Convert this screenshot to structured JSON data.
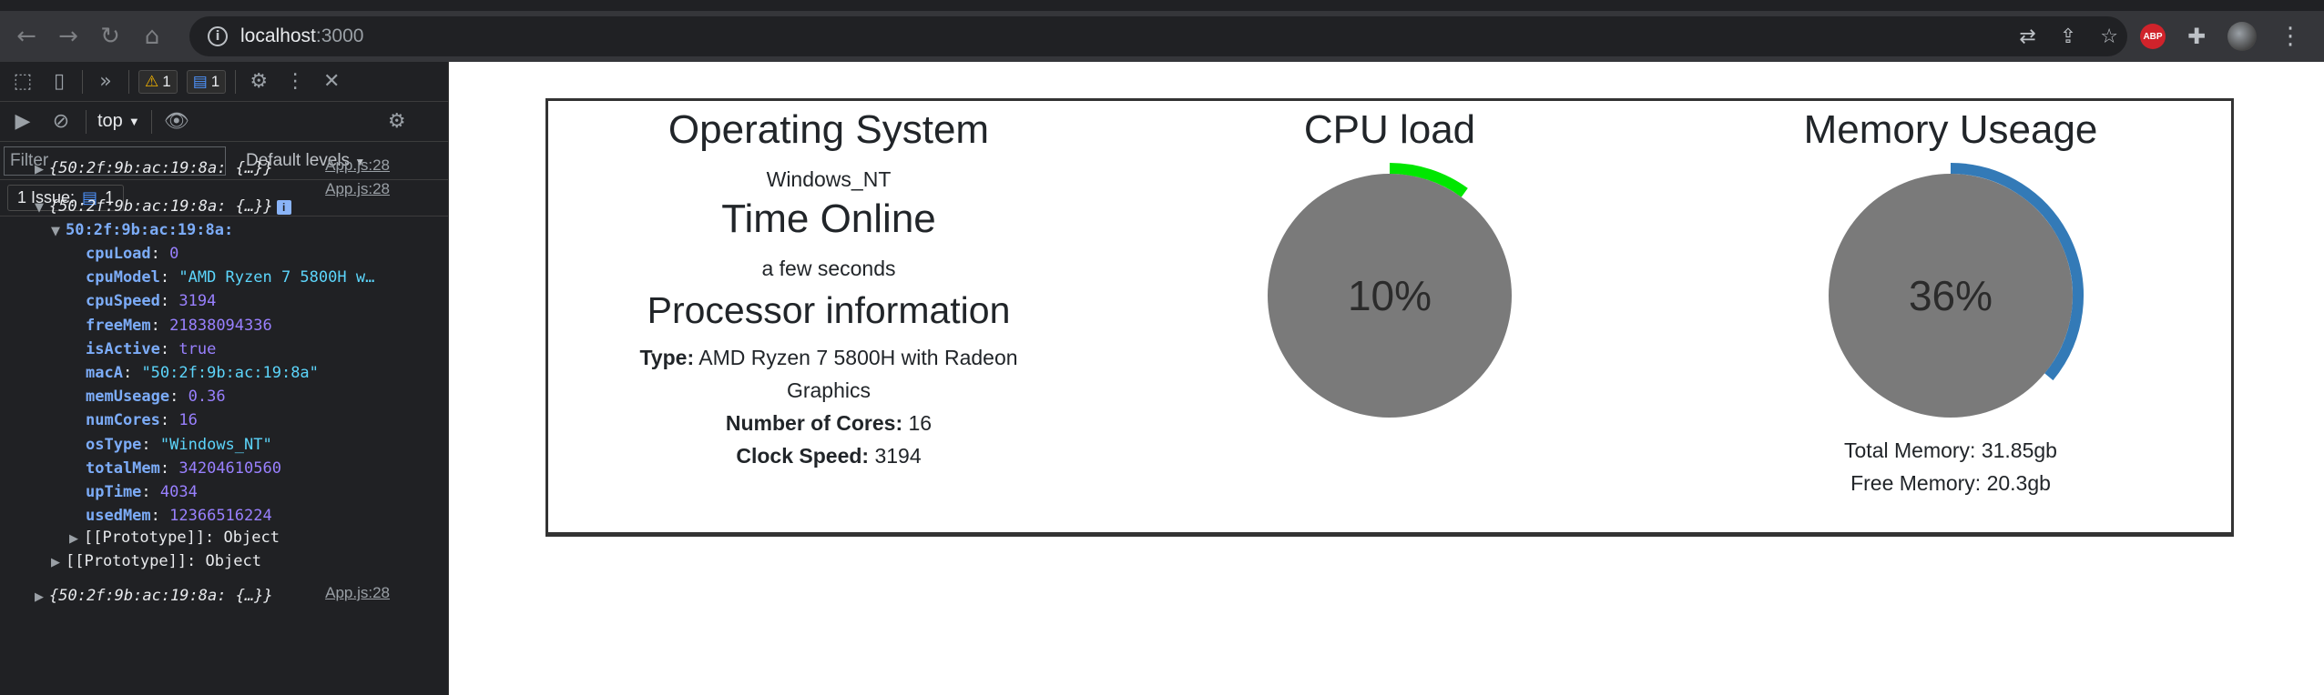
{
  "browser": {
    "url_host": "localhost",
    "url_port": ":3000"
  },
  "devtools": {
    "warn_count": "1",
    "info_count": "1",
    "context": "top",
    "filter_placeholder": "Filter",
    "levels_label": "Default levels",
    "issues_label": "1 Issue:",
    "issues_count": "1",
    "console": {
      "collapsed_obj": "{50:2f:9b:ac:19:8a: {…}}",
      "source": "App.js:28",
      "expanded_key": "50:2f:9b:ac:19:8a:",
      "props": [
        {
          "key": "cpuLoad",
          "value": "0",
          "kind": "num"
        },
        {
          "key": "cpuModel",
          "value": "\"AMD Ryzen 7 5800H w…",
          "kind": "str"
        },
        {
          "key": "cpuSpeed",
          "value": "3194",
          "kind": "num"
        },
        {
          "key": "freeMem",
          "value": "21838094336",
          "kind": "num"
        },
        {
          "key": "isActive",
          "value": "true",
          "kind": "bool"
        },
        {
          "key": "macA",
          "value": "\"50:2f:9b:ac:19:8a\"",
          "kind": "str"
        },
        {
          "key": "memUseage",
          "value": "0.36",
          "kind": "num"
        },
        {
          "key": "numCores",
          "value": "16",
          "kind": "num"
        },
        {
          "key": "osType",
          "value": "\"Windows_NT\"",
          "kind": "str"
        },
        {
          "key": "totalMem",
          "value": "34204610560",
          "kind": "num"
        },
        {
          "key": "upTime",
          "value": "4034",
          "kind": "num"
        },
        {
          "key": "usedMem",
          "value": "12366516224",
          "kind": "num"
        }
      ],
      "proto_inner": "[[Prototype]]: Object",
      "proto_outer": "[[Prototype]]: Object"
    }
  },
  "page": {
    "os": {
      "heading": "Operating System",
      "value": "Windows_NT",
      "time_heading": "Time Online",
      "time_value": "a few seconds",
      "proc_heading": "Processor information",
      "type_label": "Type:",
      "type_value": "AMD Ryzen 7 5800H with Radeon Graphics",
      "cores_label": "Number of Cores:",
      "cores_value": "16",
      "speed_label": "Clock Speed:",
      "speed_value": "3194"
    },
    "cpu": {
      "heading": "CPU load",
      "percent_label": "10%",
      "fraction": 0.1,
      "color": "#00e600"
    },
    "memory": {
      "heading": "Memory Useage",
      "percent_label": "36%",
      "fraction": 0.36,
      "color": "#337ab7",
      "total": "Total Memory: 31.85gb",
      "free": "Free Memory: 20.3gb"
    },
    "gauge_fill": "#7a7a7a"
  }
}
